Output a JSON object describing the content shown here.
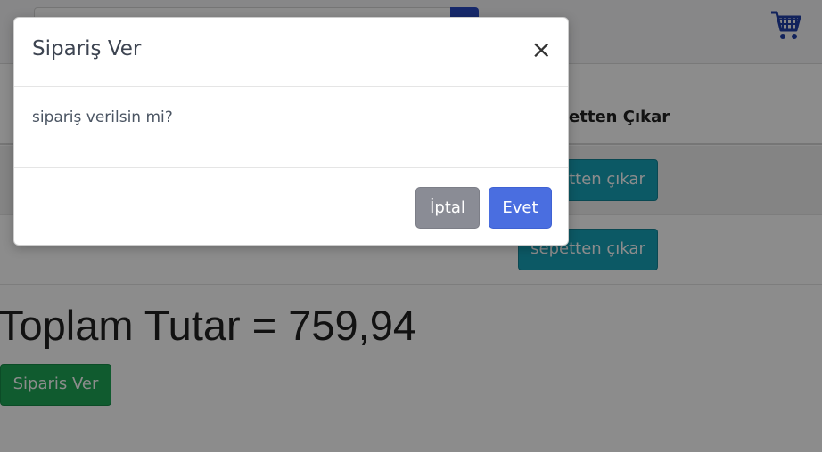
{
  "header": {
    "search_placeholder": "",
    "cart_icon": "shopping-cart-icon"
  },
  "cart_table": {
    "remove_column_header": "Sepetten Çıkar",
    "rows": [
      {
        "remove_label": "sepetten çıkar"
      },
      {
        "remove_label": "sepetten çıkar"
      }
    ]
  },
  "summary": {
    "total_text": "Toplam Tutar = 759,94",
    "order_button_label": "Siparis Ver"
  },
  "modal": {
    "title": "Sipariş Ver",
    "close_glyph": "×",
    "message": "sipariş verilsin mi?",
    "cancel_label": "İptal",
    "confirm_label": "Evet"
  },
  "colors": {
    "primary": "#4a6ee0",
    "secondary": "#8a8c95",
    "info": "#17a2b8",
    "success": "#1ea657"
  }
}
